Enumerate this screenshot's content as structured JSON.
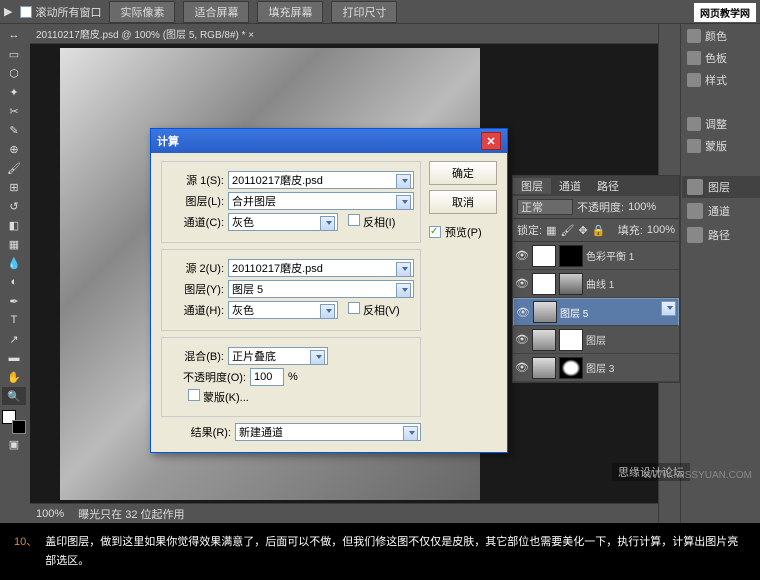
{
  "topbar": {
    "scroll_all": "滚动所有窗口",
    "btn1": "实际像素",
    "btn2": "适合屏幕",
    "btn3": "填充屏幕",
    "btn4": "打印尺寸"
  },
  "watermark": "网页教学网",
  "doc_tab": "20110217磨皮.psd @ 100% (图层 5, RGB/8#) * ×",
  "status": {
    "zoom": "100%",
    "info": "曝光只在 32 位起作用"
  },
  "panels": {
    "p1": "颜色",
    "p2": "色板",
    "p3": "样式",
    "p4": "调整",
    "p5": "蒙版"
  },
  "dialog": {
    "title": "计算",
    "src1_label": "源 1(S):",
    "src1": "20110217磨皮.psd",
    "layer1_label": "图层(L):",
    "layer1": "合并图层",
    "chan1_label": "通道(C):",
    "chan1": "灰色",
    "invert1": "反相(I)",
    "src2_label": "源 2(U):",
    "src2": "20110217磨皮.psd",
    "layer2_label": "图层(Y):",
    "layer2": "图层 5",
    "chan2_label": "通道(H):",
    "chan2": "灰色",
    "invert2": "反相(V)",
    "blend_label": "混合(B):",
    "blend": "正片叠底",
    "opacity_label": "不透明度(O):",
    "opacity": "100",
    "pct": "%",
    "mask": "蒙版(K)...",
    "result_label": "结果(R):",
    "result": "新建通道",
    "ok": "确定",
    "cancel": "取消",
    "preview": "预览(P)"
  },
  "layers_panel": {
    "tab1": "图层",
    "tab2": "通道",
    "tab3": "路径",
    "mode": "正常",
    "opacity_lbl": "不透明度:",
    "opacity": "100%",
    "lock": "锁定:",
    "fill_lbl": "填充:",
    "fill": "100%",
    "items": [
      {
        "name": "色彩平衡 1"
      },
      {
        "name": "曲线 1"
      },
      {
        "name": "图层 5"
      },
      {
        "name": "图层"
      },
      {
        "name": "图层 3"
      }
    ]
  },
  "right_tabs": {
    "t1": "图层",
    "t2": "通道",
    "t3": "路径"
  },
  "caption": {
    "num": "10、",
    "text": "盖印图层，做到这里如果你觉得效果满意了，后面可以不做，但我们修这图不仅仅是皮肤，其它部位也需要美化一下，执行计算，计算出图片亮部选区。"
  },
  "credit": "WWW.MISSYUAN.COM",
  "credit2": "思缘设计论坛"
}
